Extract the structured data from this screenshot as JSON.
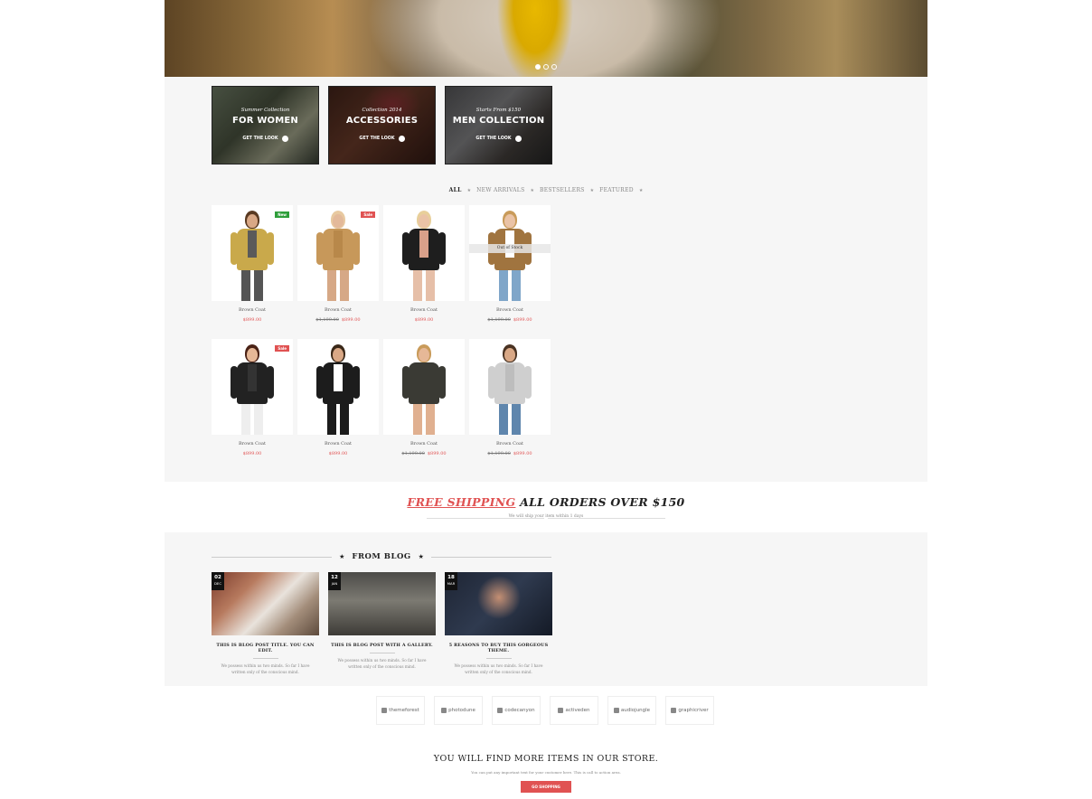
{
  "hero": {
    "slides": 3,
    "active_slide": 1
  },
  "promos": [
    {
      "subtitle": "Summer Collection",
      "title": "FOR WOMEN",
      "link": "GET THE LOOK"
    },
    {
      "subtitle": "Collection 2014",
      "title": "ACCESSORIES",
      "link": "GET THE LOOK"
    },
    {
      "subtitle": "Starts From $150",
      "title": "MEN COLLECTION",
      "link": "GET THE LOOK"
    }
  ],
  "filters": [
    "ALL",
    "NEW ARRIVALS",
    "BESTSELLERS",
    "FEATURED"
  ],
  "active_filter": "ALL",
  "products": [
    {
      "name": "Brown Coat",
      "old_price": "",
      "price": "$899.00",
      "badge": "New",
      "out_of_stock": ""
    },
    {
      "name": "Brown Coat",
      "old_price": "$1,199.00",
      "price": "$899.00",
      "badge": "Sale",
      "out_of_stock": ""
    },
    {
      "name": "Brown Coat",
      "old_price": "",
      "price": "$899.00",
      "badge": "",
      "out_of_stock": ""
    },
    {
      "name": "Brown Coat",
      "old_price": "$1,199.00",
      "price": "$899.00",
      "badge": "",
      "out_of_stock": "Out of Stock"
    },
    {
      "name": "Brown Coat",
      "old_price": "",
      "price": "$899.00",
      "badge": "Sale",
      "out_of_stock": ""
    },
    {
      "name": "Brown Coat",
      "old_price": "",
      "price": "$899.00",
      "badge": "",
      "out_of_stock": ""
    },
    {
      "name": "Brown Coat",
      "old_price": "$1,199.00",
      "price": "$899.00",
      "badge": "",
      "out_of_stock": ""
    },
    {
      "name": "Brown Coat",
      "old_price": "$1,199.00",
      "price": "$899.00",
      "badge": "",
      "out_of_stock": ""
    }
  ],
  "shipping": {
    "accent": "FREE SHIPPING",
    "rest": "ALL ORDERS OVER $150",
    "sub": "We will ship your item within 1 days"
  },
  "blog": {
    "heading": "FROM BLOG",
    "posts": [
      {
        "day": "02",
        "month": "DEC",
        "title": "THIS IS BLOG POST TITLE. YOU CAN EDIT.",
        "excerpt": "We possess within us two minds. So far I have written only of the conscious mind."
      },
      {
        "day": "12",
        "month": "JAN",
        "title": "THIS IS BLOG POST WITH A GALLERY.",
        "excerpt": "We possess within us two minds. So far I have written only of the conscious mind."
      },
      {
        "day": "18",
        "month": "MAR",
        "title": "5 REASONS TO BUY THIS GORGEOUS THEME.",
        "excerpt": "We possess within us two minds. So far I have written only of the conscious mind."
      }
    ]
  },
  "brands": [
    "themeforest",
    "photodune",
    "codecanyon",
    "activeden",
    "audiojungle",
    "graphicriver"
  ],
  "cta": {
    "title": "YOU WILL FIND MORE ITEMS IN OUR STORE.",
    "sub": "You can put any important text for your customer here. This is call to action area.",
    "button": "GO SHOPPING"
  },
  "colors": {
    "accent": "#e05252",
    "new_badge": "#2e9e3a",
    "band": "#f6f6f6"
  }
}
